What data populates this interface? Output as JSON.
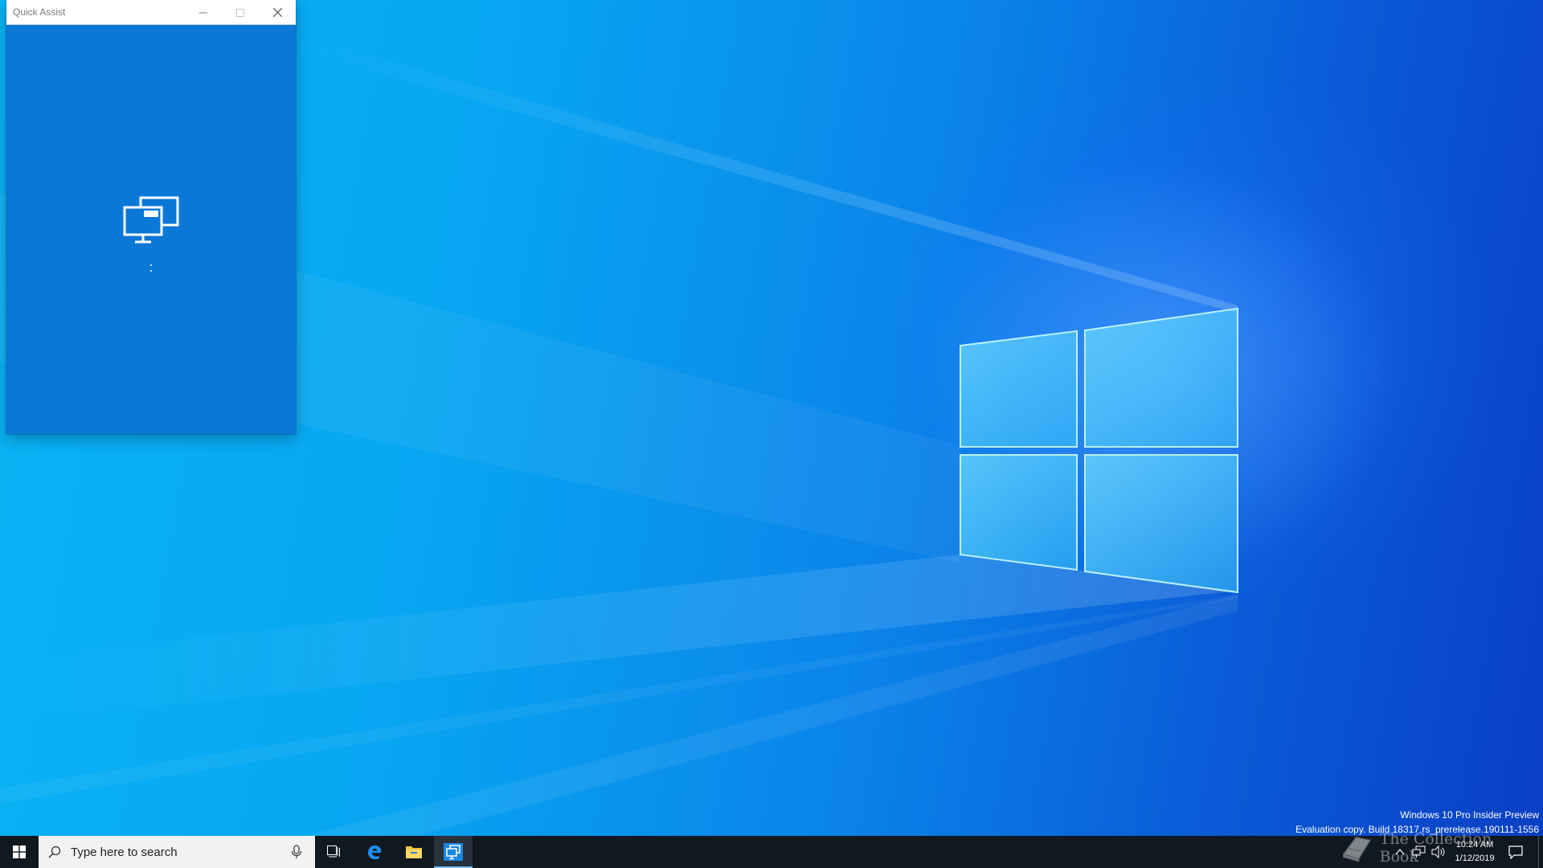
{
  "desktop": {
    "wallpaper": "Windows 10 light beam wallpaper",
    "colors": {
      "sky": "#0ab4f5",
      "deep": "#0a3fc4",
      "logo_glass": "#5fd4ff"
    }
  },
  "quick_assist": {
    "title": "Quick Assist",
    "minimize_icon": "minimize-icon",
    "maximize_icon": "maximize-icon",
    "close_icon": "close-icon",
    "center_icon": "remote-desktop-icon",
    "background_color": "#0b78d7"
  },
  "watermark": {
    "line1": "Windows 10 Pro Insider Preview",
    "line2": "Evaluation copy. Build 18317.rs_prerelease.190111-1556"
  },
  "taskbar": {
    "search_placeholder": "Type here to search",
    "apps": [
      {
        "name": "Task View",
        "icon": "task-view-icon"
      },
      {
        "name": "Microsoft Edge",
        "icon": "edge-icon"
      },
      {
        "name": "File Explorer",
        "icon": "folder-icon"
      },
      {
        "name": "Quick Assist",
        "icon": "quick-assist-icon",
        "active": true
      }
    ],
    "tray": {
      "time": "10:24 AM",
      "date": "1/12/2019"
    }
  }
}
